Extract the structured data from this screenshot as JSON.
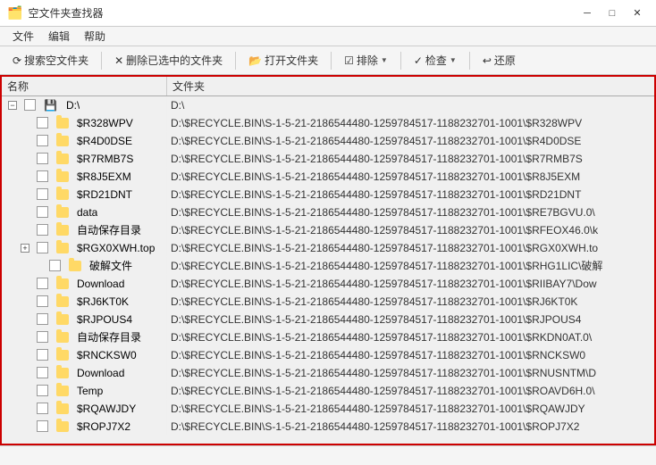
{
  "window": {
    "title": "空文件夹查找器",
    "icon": "📁",
    "controls": {
      "minimize": "─",
      "maximize": "□",
      "close": "✕"
    }
  },
  "menu": {
    "items": [
      "文件",
      "编辑",
      "帮助"
    ]
  },
  "toolbar": {
    "buttons": [
      {
        "id": "search",
        "icon": "🔍",
        "label": "搜索空文件夹"
      },
      {
        "id": "delete",
        "icon": "✕",
        "label": "删除已选中的文件夹"
      },
      {
        "id": "open",
        "icon": "📂",
        "label": "打开文件夹"
      },
      {
        "id": "exclude",
        "icon": "☑",
        "label": "排除"
      },
      {
        "id": "check",
        "icon": "✓",
        "label": "检查"
      },
      {
        "id": "restore",
        "icon": "↩",
        "label": "还原"
      }
    ]
  },
  "table": {
    "headers": {
      "name": "名称",
      "folder": "文件夹"
    },
    "rows": [
      {
        "indent": 0,
        "expand": true,
        "checkbox": true,
        "name": "D:\\",
        "folder": "D:\\",
        "is_drive": true
      },
      {
        "indent": 1,
        "expand": false,
        "checkbox": true,
        "name": "$R328WPV",
        "folder": "D:\\$RECYCLE.BIN\\S-1-5-21-2186544480-1259784517-1188232701-1001\\$R328WPV"
      },
      {
        "indent": 1,
        "expand": false,
        "checkbox": true,
        "name": "$R4D0DSE",
        "folder": "D:\\$RECYCLE.BIN\\S-1-5-21-2186544480-1259784517-1188232701-1001\\$R4D0DSE"
      },
      {
        "indent": 1,
        "expand": false,
        "checkbox": true,
        "name": "$R7RMB7S",
        "folder": "D:\\$RECYCLE.BIN\\S-1-5-21-2186544480-1259784517-1188232701-1001\\$R7RMB7S"
      },
      {
        "indent": 1,
        "expand": false,
        "checkbox": true,
        "name": "$R8J5EXM",
        "folder": "D:\\$RECYCLE.BIN\\S-1-5-21-2186544480-1259784517-1188232701-1001\\$R8J5EXM"
      },
      {
        "indent": 1,
        "expand": false,
        "checkbox": true,
        "name": "$RD21DNT",
        "folder": "D:\\$RECYCLE.BIN\\S-1-5-21-2186544480-1259784517-1188232701-1001\\$RD21DNT"
      },
      {
        "indent": 1,
        "expand": false,
        "checkbox": true,
        "name": "data",
        "folder": "D:\\$RECYCLE.BIN\\S-1-5-21-2186544480-1259784517-1188232701-1001\\$RE7BGVU.0\\"
      },
      {
        "indent": 1,
        "expand": false,
        "checkbox": true,
        "name": "自动保存目录",
        "folder": "D:\\$RECYCLE.BIN\\S-1-5-21-2186544480-1259784517-1188232701-1001\\$RFEOX46.0\\k"
      },
      {
        "indent": 1,
        "expand": true,
        "checkbox": true,
        "name": "$RGX0XWH.top",
        "folder": "D:\\$RECYCLE.BIN\\S-1-5-21-2186544480-1259784517-1188232701-1001\\$RGX0XWH.to"
      },
      {
        "indent": 2,
        "expand": false,
        "checkbox": true,
        "name": "破解文件",
        "folder": "D:\\$RECYCLE.BIN\\S-1-5-21-2186544480-1259784517-1188232701-1001\\$RHG1LIC\\破解"
      },
      {
        "indent": 1,
        "expand": false,
        "checkbox": true,
        "name": "Download",
        "folder": "D:\\$RECYCLE.BIN\\S-1-5-21-2186544480-1259784517-1188232701-1001\\$RIIBAY7\\Dow"
      },
      {
        "indent": 1,
        "expand": false,
        "checkbox": true,
        "name": "$RJ6KT0K",
        "folder": "D:\\$RECYCLE.BIN\\S-1-5-21-2186544480-1259784517-1188232701-1001\\$RJ6KT0K"
      },
      {
        "indent": 1,
        "expand": false,
        "checkbox": true,
        "name": "$RJPOUS4",
        "folder": "D:\\$RECYCLE.BIN\\S-1-5-21-2186544480-1259784517-1188232701-1001\\$RJPOUS4"
      },
      {
        "indent": 1,
        "expand": false,
        "checkbox": true,
        "name": "自动保存目录",
        "folder": "D:\\$RECYCLE.BIN\\S-1-5-21-2186544480-1259784517-1188232701-1001\\$RKDN0AT.0\\"
      },
      {
        "indent": 1,
        "expand": false,
        "checkbox": true,
        "name": "$RNCKSW0",
        "folder": "D:\\$RECYCLE.BIN\\S-1-5-21-2186544480-1259784517-1188232701-1001\\$RNCKSW0"
      },
      {
        "indent": 1,
        "expand": false,
        "checkbox": true,
        "name": "Download",
        "folder": "D:\\$RECYCLE.BIN\\S-1-5-21-2186544480-1259784517-1188232701-1001\\$RNUSNTM\\D"
      },
      {
        "indent": 1,
        "expand": false,
        "checkbox": true,
        "name": "Temp",
        "folder": "D:\\$RECYCLE.BIN\\S-1-5-21-2186544480-1259784517-1188232701-1001\\$ROAVD6H.0\\"
      },
      {
        "indent": 1,
        "expand": false,
        "checkbox": true,
        "name": "$RQAWJDY",
        "folder": "D:\\$RECYCLE.BIN\\S-1-5-21-2186544480-1259784517-1188232701-1001\\$RQAWJDY"
      },
      {
        "indent": 1,
        "expand": false,
        "checkbox": true,
        "name": "$ROPJ7X2",
        "folder": "D:\\$RECYCLE.BIN\\S-1-5-21-2186544480-1259784517-1188232701-1001\\$ROPJ7X2"
      }
    ]
  },
  "statusbar": {
    "text": ""
  },
  "colors": {
    "border_red": "#cc0000",
    "header_bg": "#f0f0f0",
    "folder_yellow": "#ffd966",
    "selected_blue": "#cce4f7"
  }
}
